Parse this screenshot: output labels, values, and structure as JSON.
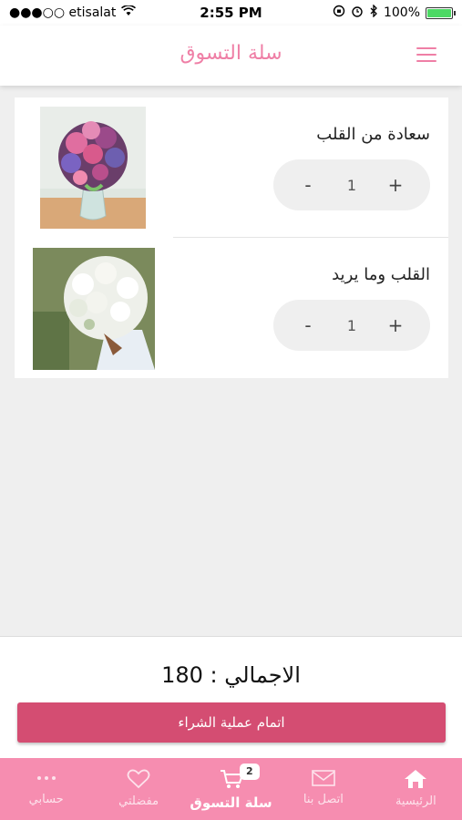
{
  "status_bar": {
    "carrier": "●●●○○ etisalat",
    "time": "2:55 PM",
    "battery": "100%"
  },
  "header": {
    "title": "سلة التسوق"
  },
  "cart": {
    "items": [
      {
        "name": "سعادة من القلب",
        "quantity": "1",
        "minus": "-",
        "plus": "+",
        "image_icon": "flower-bouquet-vase-image"
      },
      {
        "name": "القلب وما يريد",
        "quantity": "1",
        "minus": "-",
        "plus": "+",
        "image_icon": "white-bouquet-image"
      }
    ]
  },
  "summary": {
    "total_label": "الاجمالي : 180",
    "checkout_label": "اتمام عملية الشراء"
  },
  "tabs": [
    {
      "label": "حسابي",
      "icon": "more-dots-icon"
    },
    {
      "label": "مفضلتي",
      "icon": "heart-icon"
    },
    {
      "label": "سلة التسوق",
      "icon": "cart-icon",
      "badge": "2",
      "active": true
    },
    {
      "label": "اتصل بنا",
      "icon": "mail-icon"
    },
    {
      "label": "الرئيسية",
      "icon": "home-icon"
    }
  ],
  "colors": {
    "accent": "#ef7fa6",
    "checkout_button": "#d44d72",
    "tab_bar": "#f68db0",
    "background": "#efefef"
  }
}
